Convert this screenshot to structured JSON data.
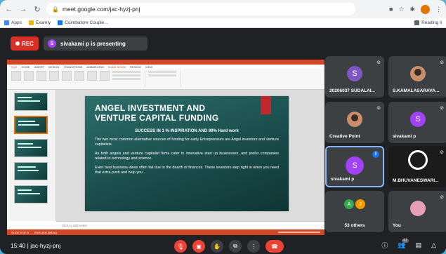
{
  "browser": {
    "url": "meet.google.com/jac-hyzj-pnj",
    "bookmarks": [
      {
        "label": "Apps",
        "color": "#4285f4"
      },
      {
        "label": "Examly",
        "color": "#f4b400"
      },
      {
        "label": "Coimbatore Couple...",
        "color": "#1a73e8"
      }
    ],
    "reading_list": "Reading li"
  },
  "meet": {
    "rec_label": "REC",
    "presenting_initial": "S",
    "presenting_text": "sivakami p is presenting",
    "meeting_time": "15:40",
    "meeting_code": "jac-hyzj-pnj",
    "participant_count": "61"
  },
  "ppt": {
    "tabs": [
      "FILE",
      "HOME",
      "INSERT",
      "DESIGN",
      "TRANSITIONS",
      "ANIMATIONS",
      "SLIDE SHOW",
      "REVIEW",
      "VIEW"
    ],
    "notes_placeholder": "Click to add notes",
    "status_left": "SLIDE 5 OF 8",
    "status_lang": "ENGLISH (INDIA)"
  },
  "slide": {
    "title_line1": "ANGEL INVESTMENT AND",
    "title_line2": "VENTURE CAPITAL FUNDING",
    "subtitle": "SUCCESS IN 1 % INSPIRATION AND 99% Hard work",
    "para1": "The two most common alternative sources of funding for early Entrepreneurs are Angel investors and Venture capitalists.",
    "para2": "As both angels and venture capitalist firms cater to innovative start up businesses, and prefer companies related to technology and science.",
    "para3": "Even best business ideas often fail due to the dearth of finances. These investors step right in when you need that extra push and help you ."
  },
  "participants": [
    {
      "name": "20206037 SUDALAI...",
      "initial": "S",
      "color": "#7e57c2",
      "kind": "initial"
    },
    {
      "name": "S.KAMALASARAVA...",
      "initial": "",
      "color": "#c98e6b",
      "kind": "photo"
    },
    {
      "name": "Creative Point",
      "initial": "",
      "color": "#c98e6b",
      "kind": "photo"
    },
    {
      "name": "sivakami p",
      "initial": "S",
      "color": "#a142f4",
      "kind": "initial"
    },
    {
      "name": "sivakami p",
      "initial": "S",
      "color": "#a142f4",
      "kind": "speaking"
    },
    {
      "name": "M.BHUVANESWARI...",
      "initial": "",
      "color": "#1b1b1b",
      "kind": "logo"
    },
    {
      "name": "53 others",
      "initial": "",
      "color": "#3c4043",
      "kind": "others"
    },
    {
      "name": "You",
      "initial": "",
      "color": "#e8a0b8",
      "kind": "photo"
    }
  ],
  "others_avatars": [
    {
      "initial": "A",
      "color": "#34a853"
    },
    {
      "initial": "J",
      "color": "#f29900"
    }
  ]
}
